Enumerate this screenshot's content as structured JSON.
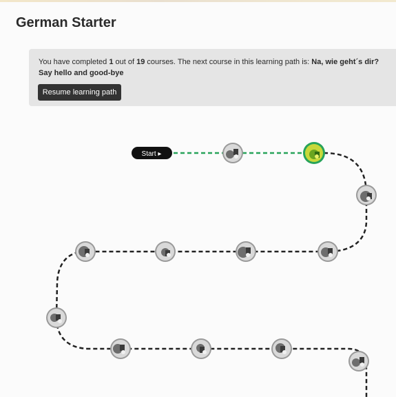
{
  "page": {
    "title": "German Starter"
  },
  "progress": {
    "prefix": "You have completed ",
    "completed": "1",
    "middle1": " out of ",
    "total": "19",
    "middle2": " courses. The next course in this learning path is: ",
    "next_course": "Na, wie geht´s dir? Say hello and good-bye"
  },
  "buttons": {
    "resume_label": "Resume learning path"
  },
  "path": {
    "start_label": "Start ▸",
    "colors": {
      "completed_line": "#27a35a",
      "current_ring": "#27a35a",
      "remaining_line": "#222222",
      "start_pill": "#111111"
    },
    "nodes": [
      {
        "status": "completed",
        "icon": "course-thumbnail"
      },
      {
        "status": "current",
        "icon": "course-thumbnail"
      },
      {
        "status": "locked",
        "icon": "course-thumbnail"
      },
      {
        "status": "locked",
        "icon": "course-thumbnail"
      },
      {
        "status": "locked",
        "icon": "course-thumbnail"
      },
      {
        "status": "locked",
        "icon": "course-thumbnail"
      },
      {
        "status": "locked",
        "icon": "course-thumbnail"
      },
      {
        "status": "locked",
        "icon": "course-thumbnail"
      },
      {
        "status": "locked",
        "icon": "course-thumbnail"
      },
      {
        "status": "locked",
        "icon": "course-thumbnail"
      },
      {
        "status": "locked",
        "icon": "course-thumbnail"
      },
      {
        "status": "locked",
        "icon": "course-thumbnail"
      },
      {
        "status": "locked",
        "icon": "course-thumbnail"
      }
    ]
  }
}
